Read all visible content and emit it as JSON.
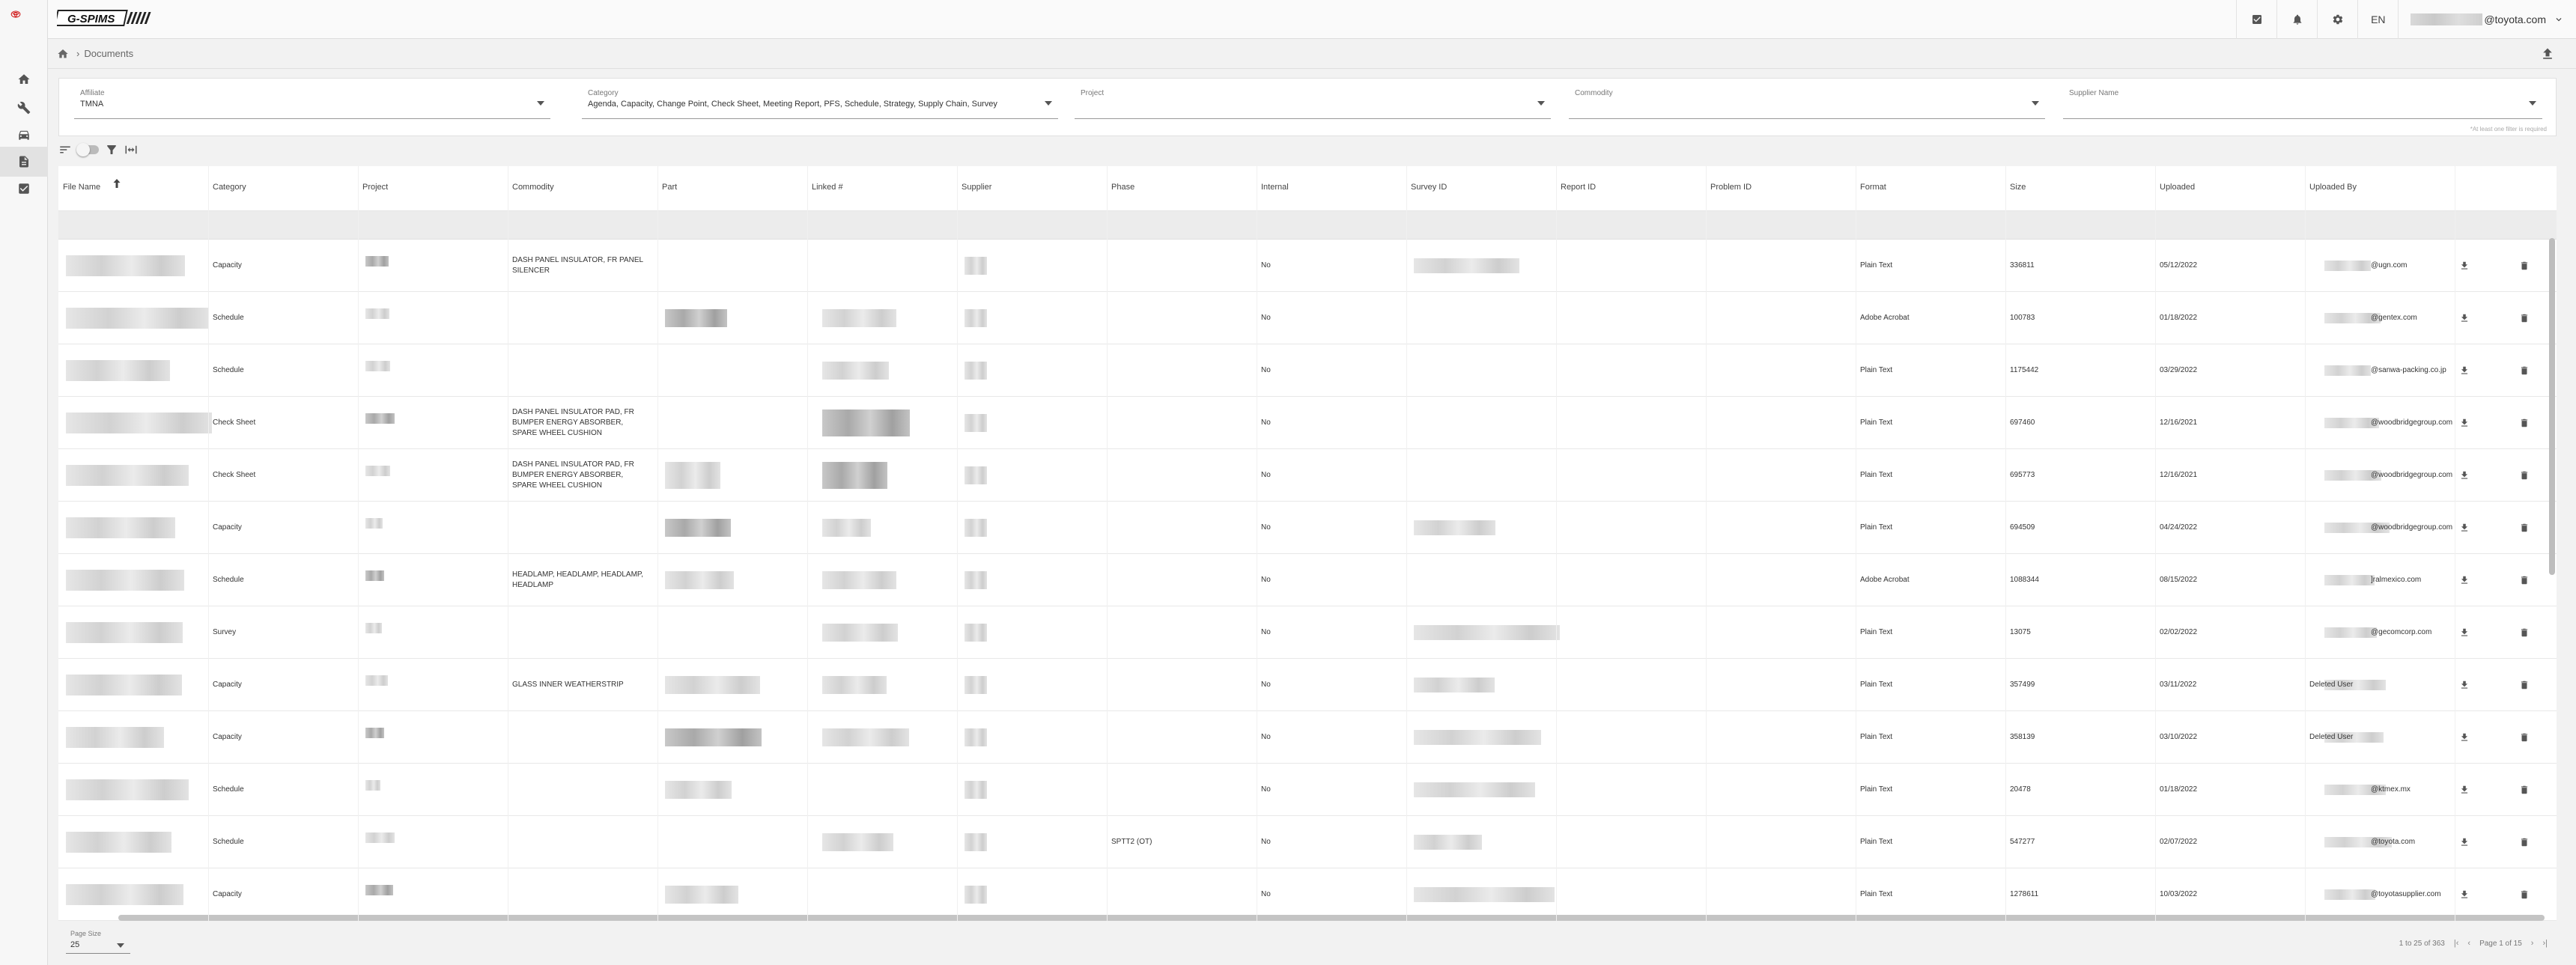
{
  "header": {
    "brand": "G-SPIMS",
    "user_suffix": "@toyota.com",
    "language": "EN"
  },
  "rail": [
    "home-icon",
    "tools-icon",
    "car-icon",
    "document-icon",
    "checkbox-icon"
  ],
  "breadcrumb": {
    "current": "Documents"
  },
  "filters": {
    "affiliate": {
      "label": "Affiliate",
      "value": "TMNA"
    },
    "category": {
      "label": "Category",
      "value": "Agenda, Capacity, Change Point, Check Sheet, Meeting Report, PFS, Schedule, Strategy, Supply Chain, Survey"
    },
    "project": {
      "label": "Project",
      "value": ""
    },
    "commodity": {
      "label": "Commodity",
      "value": ""
    },
    "supplier": {
      "label": "Supplier Name",
      "value": ""
    },
    "note": "*At least one filter is required"
  },
  "columns": [
    "File Name",
    "Category",
    "Project",
    "Commodity",
    "Part",
    "Linked #",
    "Supplier",
    "Phase",
    "Internal",
    "Survey ID",
    "Report ID",
    "Problem ID",
    "Format",
    "Size",
    "Uploaded",
    "Uploaded By"
  ],
  "rows": [
    {
      "category": "Capacity",
      "commodity": "DASH PANEL INSULATOR, FR PANEL SILENCER",
      "phase": "",
      "internal": "No",
      "format": "Plain Text",
      "size": "336811",
      "uploaded": "05/12/2022",
      "by": "@ugn.com"
    },
    {
      "category": "Schedule",
      "commodity": "",
      "phase": "",
      "internal": "No",
      "format": "Adobe Acrobat",
      "size": "100783",
      "uploaded": "01/18/2022",
      "by": "@gentex.com"
    },
    {
      "category": "Schedule",
      "commodity": "",
      "phase": "",
      "internal": "No",
      "format": "Plain Text",
      "size": "1175442",
      "uploaded": "03/29/2022",
      "by": "@sanwa-packing.co.jp"
    },
    {
      "category": "Check Sheet",
      "commodity": "DASH PANEL INSULATOR PAD, FR BUMPER ENERGY ABSORBER, SPARE WHEEL CUSHION",
      "phase": "",
      "internal": "No",
      "format": "Plain Text",
      "size": "697460",
      "uploaded": "12/16/2021",
      "by": "@woodbridgegroup.com"
    },
    {
      "category": "Check Sheet",
      "commodity": "DASH PANEL INSULATOR PAD, FR BUMPER ENERGY ABSORBER, SPARE WHEEL CUSHION",
      "phase": "",
      "internal": "No",
      "format": "Plain Text",
      "size": "695773",
      "uploaded": "12/16/2021",
      "by": "@woodbridgegroup.com"
    },
    {
      "category": "Capacity",
      "commodity": "",
      "phase": "",
      "internal": "No",
      "format": "Plain Text",
      "size": "694509",
      "uploaded": "04/24/2022",
      "by": "@woodbridgegroup.com"
    },
    {
      "category": "Schedule",
      "commodity": "HEADLAMP, HEADLAMP, HEADLAMP, HEADLAMP",
      "phase": "",
      "internal": "No",
      "format": "Adobe Acrobat",
      "size": "1088344",
      "uploaded": "08/15/2022",
      "by": "]ralmexico.com"
    },
    {
      "category": "Survey",
      "commodity": "",
      "phase": "",
      "internal": "No",
      "format": "Plain Text",
      "size": "13075",
      "uploaded": "02/02/2022",
      "by": "@gecomcorp.com"
    },
    {
      "category": "Capacity",
      "commodity": "GLASS INNER WEATHERSTRIP",
      "phase": "",
      "internal": "No",
      "format": "Plain Text",
      "size": "357499",
      "uploaded": "03/11/2022",
      "by": "Deleted User"
    },
    {
      "category": "Capacity",
      "commodity": "",
      "phase": "",
      "internal": "No",
      "format": "Plain Text",
      "size": "358139",
      "uploaded": "03/10/2022",
      "by": "Deleted User"
    },
    {
      "category": "Schedule",
      "commodity": "",
      "phase": "",
      "internal": "No",
      "format": "Plain Text",
      "size": "20478",
      "uploaded": "01/18/2022",
      "by": "@ktmex.mx"
    },
    {
      "category": "Schedule",
      "commodity": "",
      "phase": "SPTT2 (OT)",
      "internal": "No",
      "format": "Plain Text",
      "size": "547277",
      "uploaded": "02/07/2022",
      "by": "@toyota.com"
    },
    {
      "category": "Capacity",
      "commodity": "",
      "phase": "",
      "internal": "No",
      "format": "Plain Text",
      "size": "1278611",
      "uploaded": "10/03/2022",
      "by": "@toyotasupplier.com"
    }
  ],
  "footer": {
    "page_size_label": "Page Size",
    "page_size": "25",
    "range": "1 to 25 of 363",
    "page": "Page 1 of 15"
  },
  "colors": {
    "accent": "#555555",
    "header_bg": "#fafafa",
    "filter_row_bg": "#ececec"
  }
}
